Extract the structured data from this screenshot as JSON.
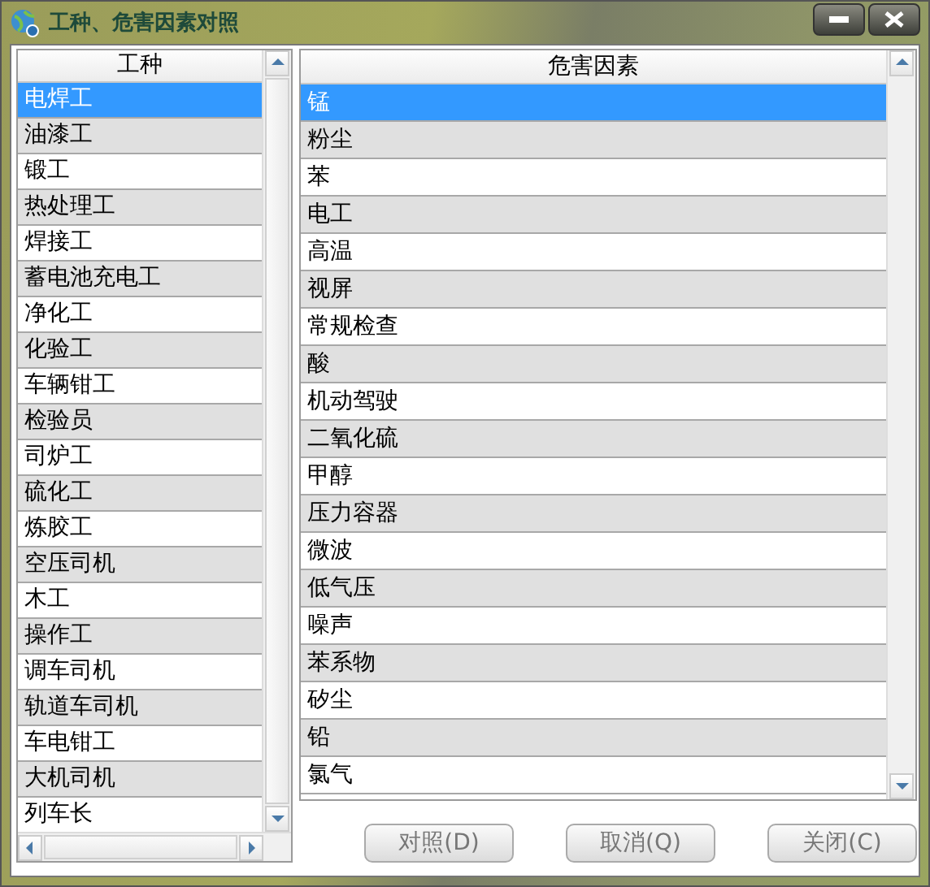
{
  "window": {
    "title": "工种、危害因素对照"
  },
  "job_list": {
    "header": "工种",
    "rows": [
      {
        "text": "电焊工",
        "selected": true
      },
      {
        "text": "油漆工",
        "selected": false
      },
      {
        "text": "锻工",
        "selected": false
      },
      {
        "text": "热处理工",
        "selected": false
      },
      {
        "text": "焊接工",
        "selected": false
      },
      {
        "text": "蓄电池充电工",
        "selected": false
      },
      {
        "text": "净化工",
        "selected": false
      },
      {
        "text": "化验工",
        "selected": false
      },
      {
        "text": "车辆钳工",
        "selected": false
      },
      {
        "text": "检验员",
        "selected": false
      },
      {
        "text": "司炉工",
        "selected": false
      },
      {
        "text": "硫化工",
        "selected": false
      },
      {
        "text": "炼胶工",
        "selected": false
      },
      {
        "text": "空压司机",
        "selected": false
      },
      {
        "text": "木工",
        "selected": false
      },
      {
        "text": "操作工",
        "selected": false
      },
      {
        "text": "调车司机",
        "selected": false
      },
      {
        "text": "轨道车司机",
        "selected": false
      },
      {
        "text": "车电钳工",
        "selected": false
      },
      {
        "text": "大机司机",
        "selected": false
      },
      {
        "text": "列车长",
        "selected": false
      }
    ]
  },
  "hazard_list": {
    "header": "危害因素",
    "rows": [
      {
        "text": "锰",
        "selected": true
      },
      {
        "text": "粉尘",
        "selected": false
      },
      {
        "text": "苯",
        "selected": false
      },
      {
        "text": "电工",
        "selected": false
      },
      {
        "text": "高温",
        "selected": false
      },
      {
        "text": "视屏",
        "selected": false
      },
      {
        "text": "常规检查",
        "selected": false
      },
      {
        "text": "酸",
        "selected": false
      },
      {
        "text": "机动驾驶",
        "selected": false
      },
      {
        "text": "二氧化硫",
        "selected": false
      },
      {
        "text": "甲醇",
        "selected": false
      },
      {
        "text": "压力容器",
        "selected": false
      },
      {
        "text": "微波",
        "selected": false
      },
      {
        "text": "低气压",
        "selected": false
      },
      {
        "text": "噪声",
        "selected": false
      },
      {
        "text": "苯系物",
        "selected": false
      },
      {
        "text": "矽尘",
        "selected": false
      },
      {
        "text": "铅",
        "selected": false
      },
      {
        "text": "氯气",
        "selected": false
      }
    ]
  },
  "buttons": [
    "对照(D)",
    "取消(Q)",
    "关闭(C)"
  ]
}
